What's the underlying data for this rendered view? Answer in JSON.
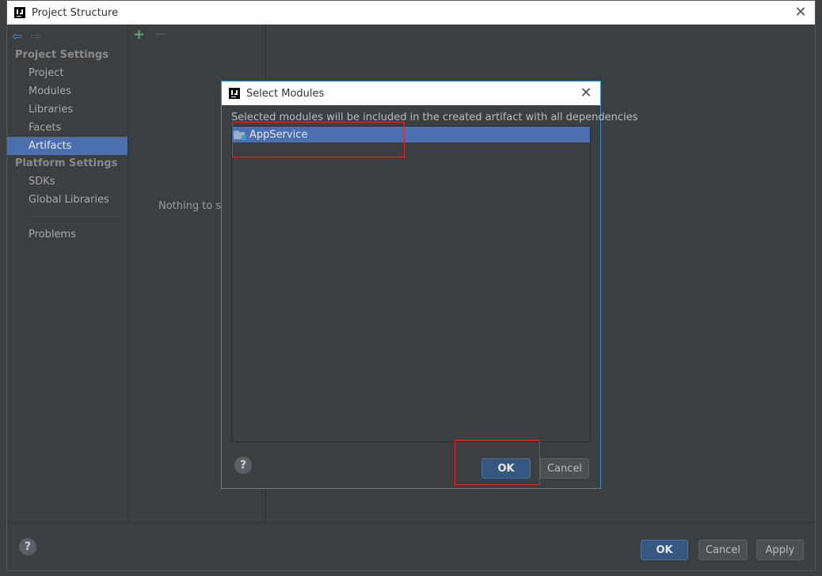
{
  "window": {
    "title": "Project Structure",
    "close_glyph": "✕"
  },
  "sidebar": {
    "project_settings_title": "Project Settings",
    "project_items": [
      {
        "label": "Project"
      },
      {
        "label": "Modules"
      },
      {
        "label": "Libraries"
      },
      {
        "label": "Facets"
      },
      {
        "label": "Artifacts",
        "selected": true
      }
    ],
    "platform_settings_title": "Platform Settings",
    "platform_items": [
      {
        "label": "SDKs"
      },
      {
        "label": "Global Libraries"
      }
    ],
    "problems_label": "Problems"
  },
  "artifacts_panel": {
    "add_glyph": "+",
    "remove_glyph": "−",
    "empty_text": "Nothing to sh"
  },
  "main_footer": {
    "help_glyph": "?",
    "ok_label": "OK",
    "cancel_label": "Cancel",
    "apply_label": "Apply"
  },
  "dialog": {
    "title": "Select Modules",
    "close_glyph": "✕",
    "description": "Selected modules will be included in the created artifact with all dependencies",
    "modules": [
      {
        "name": "AppService",
        "selected": true
      }
    ],
    "help_glyph": "?",
    "ok_label": "OK",
    "cancel_label": "Cancel"
  },
  "colors": {
    "accent_selection": "#4b6eaf",
    "annotation_red": "#e0282f",
    "dialog_border": "#3592c4"
  }
}
